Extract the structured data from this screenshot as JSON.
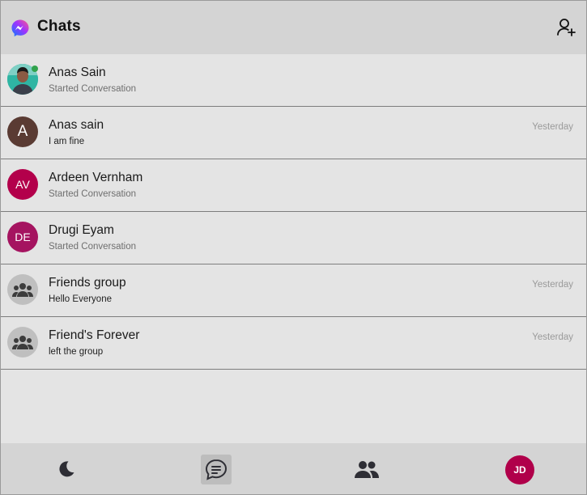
{
  "header": {
    "title": "Chats",
    "logo_icon": "messenger-logo-icon",
    "add_friend_icon": "add-person-icon"
  },
  "chats": [
    {
      "name": "Anas Sain",
      "preview": "Started Conversation",
      "time": "",
      "avatar_type": "photo",
      "online": true
    },
    {
      "name": "Anas sain",
      "preview": "I am fine",
      "time": "Yesterday",
      "avatar_type": "letter",
      "avatar_text": "A",
      "avatar_color": "#5a3b33"
    },
    {
      "name": "Ardeen Vernham",
      "preview": "Started Conversation",
      "time": "",
      "avatar_type": "initials",
      "avatar_text": "AV",
      "avatar_color": "#b3004b"
    },
    {
      "name": "Drugi Eyam",
      "preview": "Started Conversation",
      "time": "",
      "avatar_type": "initials",
      "avatar_text": "DE",
      "avatar_color": "#a51460"
    },
    {
      "name": "Friends group",
      "preview": "Hello Everyone",
      "time": "Yesterday",
      "avatar_type": "group"
    },
    {
      "name": "Friend's Forever",
      "preview": "left the group",
      "time": "Yesterday",
      "avatar_type": "group"
    }
  ],
  "bottom_nav": {
    "theme_icon": "moon-icon",
    "chats_icon": "chat-bubble-icon",
    "people_icon": "people-icon",
    "profile_initials": "JD",
    "profile_color": "#b0004a"
  },
  "colors": {
    "header_bg": "#d4d4d4",
    "list_bg": "#e4e4e4",
    "online": "#31a24c"
  }
}
